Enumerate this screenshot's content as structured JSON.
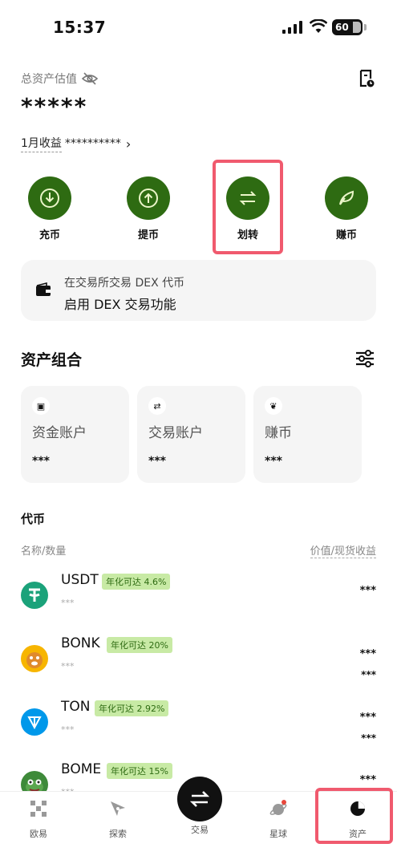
{
  "status_bar": {
    "time": "15:37",
    "battery": "60"
  },
  "overview": {
    "total_label": "总资产估值",
    "total_value": "*****",
    "monthly_label": "1月收益",
    "monthly_value": "**********"
  },
  "actions": [
    {
      "label": "充币",
      "icon": "deposit-icon"
    },
    {
      "label": "提币",
      "icon": "withdraw-icon"
    },
    {
      "label": "划转",
      "icon": "transfer-icon"
    },
    {
      "label": "赚币",
      "icon": "earn-icon"
    }
  ],
  "dex_card": {
    "subtitle": "在交易所交易 DEX 代币",
    "title": "启用 DEX 交易功能"
  },
  "portfolio": {
    "title": "资产组合",
    "accounts": [
      {
        "name": "资金账户",
        "value": "***",
        "icon": "wallet-icon"
      },
      {
        "name": "交易账户",
        "value": "***",
        "icon": "swap-icon"
      },
      {
        "name": "赚币",
        "value": "***",
        "icon": "leaf-icon"
      }
    ]
  },
  "tokens": {
    "title": "代币",
    "col_left": "名称/数量",
    "col_right": "价值/现货收益",
    "items": [
      {
        "symbol": "USDT",
        "badge": "年化可达 4.6%",
        "amount": "***",
        "value": "***",
        "pnl": "",
        "color": "#1ba27a"
      },
      {
        "symbol": "BONK",
        "badge": "年化可达 20%",
        "amount": "***",
        "value": "***",
        "pnl": "***",
        "color": "#f7b500"
      },
      {
        "symbol": "TON",
        "badge": "年化可达 2.92%",
        "amount": "***",
        "value": "***",
        "pnl": "***",
        "color": "#0098ea"
      },
      {
        "symbol": "BOME",
        "badge": "年化可达 15%",
        "amount": "***",
        "value": "***",
        "pnl": "***",
        "color": "#3e8a3a"
      }
    ]
  },
  "tabbar": {
    "items": [
      {
        "label": "欧易",
        "icon": "okx-logo-icon"
      },
      {
        "label": "探索",
        "icon": "compass-icon"
      },
      {
        "label": "交易",
        "icon": "trade-swap-icon"
      },
      {
        "label": "星球",
        "icon": "planet-icon"
      },
      {
        "label": "资产",
        "icon": "pie-chart-icon"
      }
    ]
  },
  "colors": {
    "brand_green": "#2e6b12",
    "highlight": "#f05a6e",
    "badge_bg": "#c8eaa5"
  }
}
